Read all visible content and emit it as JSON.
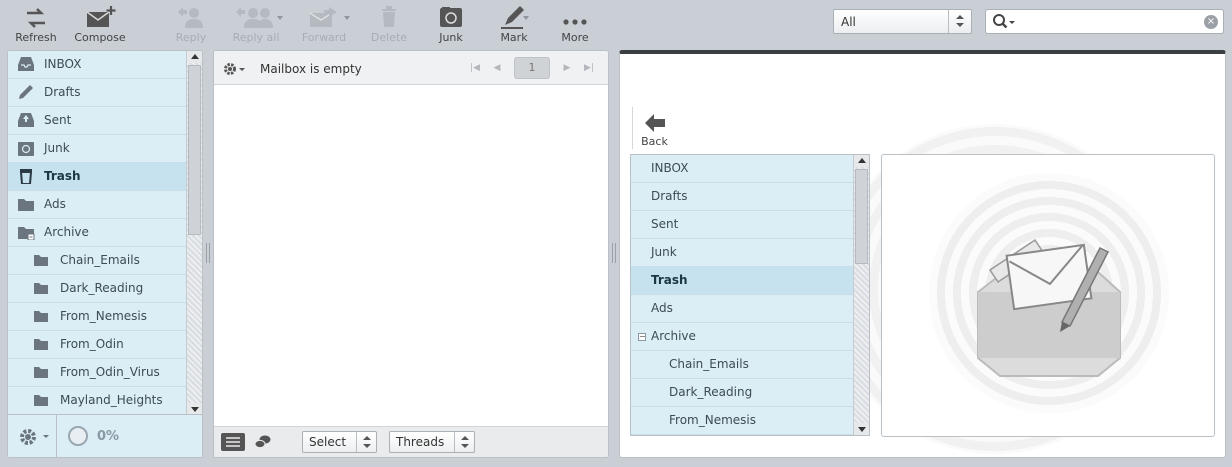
{
  "toolbar": {
    "refresh": "Refresh",
    "compose": "Compose",
    "reply": "Reply",
    "reply_all": "Reply all",
    "forward": "Forward",
    "delete": "Delete",
    "junk": "Junk",
    "mark": "Mark",
    "more": "More"
  },
  "filter": {
    "selected": "All"
  },
  "search": {
    "value": "",
    "clear": "×"
  },
  "folders": {
    "items": [
      {
        "label": "INBOX",
        "icon": "inbox-icon"
      },
      {
        "label": "Drafts",
        "icon": "pencil-icon"
      },
      {
        "label": "Sent",
        "icon": "sent-icon"
      },
      {
        "label": "Junk",
        "icon": "junk-icon"
      },
      {
        "label": "Trash",
        "icon": "trash-icon"
      },
      {
        "label": "Ads",
        "icon": "folder-icon"
      },
      {
        "label": "Archive",
        "icon": "archive-folder-icon"
      },
      {
        "label": "Chain_Emails",
        "icon": "folder-icon"
      },
      {
        "label": "Dark_Reading",
        "icon": "folder-icon"
      },
      {
        "label": "From_Nemesis",
        "icon": "folder-icon"
      },
      {
        "label": "From_Odin",
        "icon": "folder-icon"
      },
      {
        "label": "From_Odin_Virus",
        "icon": "folder-icon"
      },
      {
        "label": "Mayland_Heights",
        "icon": "folder-icon"
      }
    ],
    "selected": "Trash",
    "quota": "0%"
  },
  "message_list": {
    "status": "Mailbox is empty",
    "page": "1",
    "select_label": "Select",
    "threads_label": "Threads"
  },
  "preview": {
    "back": "Back",
    "folders": [
      {
        "label": "INBOX"
      },
      {
        "label": "Drafts"
      },
      {
        "label": "Sent"
      },
      {
        "label": "Junk"
      },
      {
        "label": "Trash"
      },
      {
        "label": "Ads"
      },
      {
        "label": "Archive"
      },
      {
        "label": "Chain_Emails"
      },
      {
        "label": "Dark_Reading"
      },
      {
        "label": "From_Nemesis"
      }
    ]
  },
  "colors": {
    "selected_row": "#c7e2ef",
    "row": "#dbedf5",
    "chrome": "#c9cfd5"
  }
}
